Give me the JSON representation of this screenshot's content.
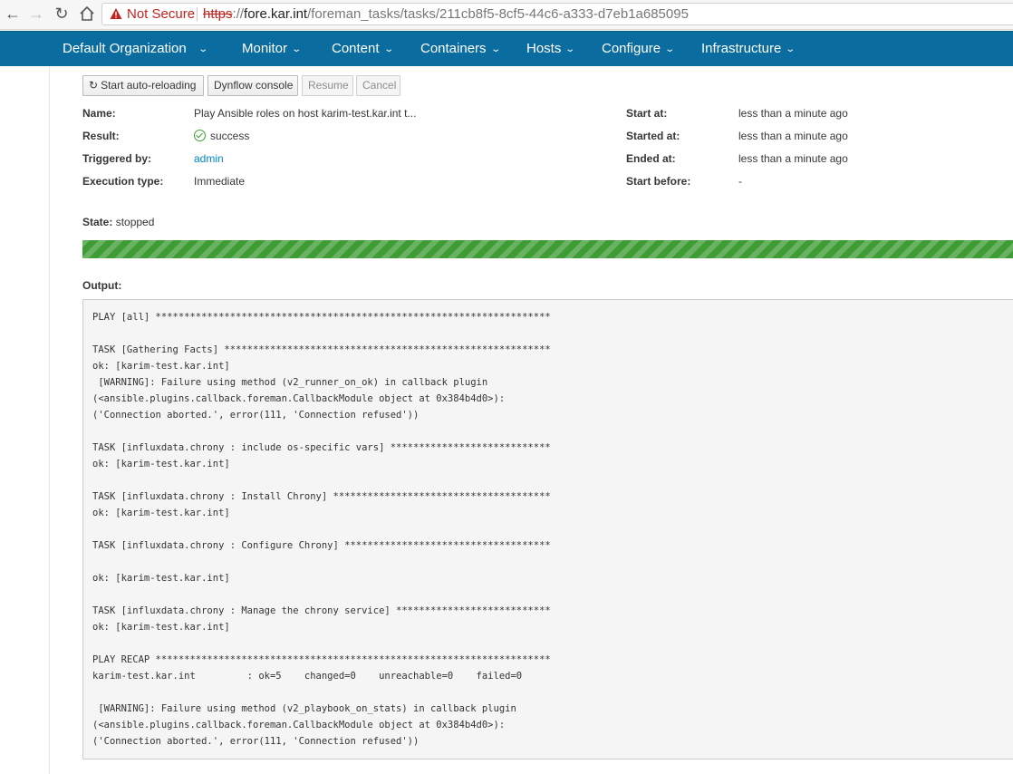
{
  "browser": {
    "security_label": "Not Secure",
    "url_scheme": "https",
    "url_sep": "://",
    "url_host": "fore.kar.int",
    "url_path": "/foreman_tasks/tasks/211cb8f5-8cf5-44c6-a333-d7eb1a685095"
  },
  "navbar": {
    "items": [
      "Default Organization",
      "Monitor",
      "Content",
      "Containers",
      "Hosts",
      "Configure",
      "Infrastructure"
    ]
  },
  "toolbar": {
    "auto_reload": "Start auto-reloading",
    "dynflow": "Dynflow console",
    "resume": "Resume",
    "cancel": "Cancel"
  },
  "task": {
    "name_label": "Name:",
    "name": "Play Ansible roles on host karim-test.kar.int t...",
    "result_label": "Result:",
    "result": "success",
    "triggered_label": "Triggered by:",
    "triggered_by": "admin",
    "exec_label": "Execution type:",
    "exec_type": "Immediate",
    "start_at_label": "Start at:",
    "start_at": "less than a minute ago",
    "started_at_label": "Started at:",
    "started_at": "less than a minute ago",
    "ended_at_label": "Ended at:",
    "ended_at": "less than a minute ago",
    "start_before_label": "Start before:",
    "start_before": "-",
    "state_label": "State:",
    "state": "stopped",
    "progress": 1.0,
    "output_label": "Output:"
  },
  "output": {
    "lines": [
      "PLAY [all] *********************************************************************",
      "",
      "TASK [Gathering Facts] *********************************************************",
      "ok: [karim-test.kar.int]",
      " [WARNING]: Failure using method (v2_runner_on_ok) in callback plugin",
      "(<ansible.plugins.callback.foreman.CallbackModule object at 0x384b4d0>):",
      "('Connection aborted.', error(111, 'Connection refused'))",
      "",
      "TASK [influxdata.chrony : include os-specific vars] ****************************",
      "ok: [karim-test.kar.int]",
      "",
      "TASK [influxdata.chrony : Install Chrony] **************************************",
      "ok: [karim-test.kar.int]",
      "",
      "TASK [influxdata.chrony : Configure Chrony] ************************************",
      "",
      "ok: [karim-test.kar.int]",
      "",
      "TASK [influxdata.chrony : Manage the chrony service] ***************************",
      "ok: [karim-test.kar.int]",
      "",
      "PLAY RECAP *********************************************************************",
      "karim-test.kar.int         : ok=5    changed=0    unreachable=0    failed=0",
      "",
      " [WARNING]: Failure using method (v2_playbook_on_stats) in callback plugin",
      "(<ansible.plugins.callback.foreman.CallbackModule object at 0x384b4d0>):",
      "('Connection aborted.', error(111, 'Connection refused'))"
    ]
  },
  "colors": {
    "navbar": "#0a6c9f",
    "success": "#3f9c35",
    "link": "#0088ce"
  }
}
